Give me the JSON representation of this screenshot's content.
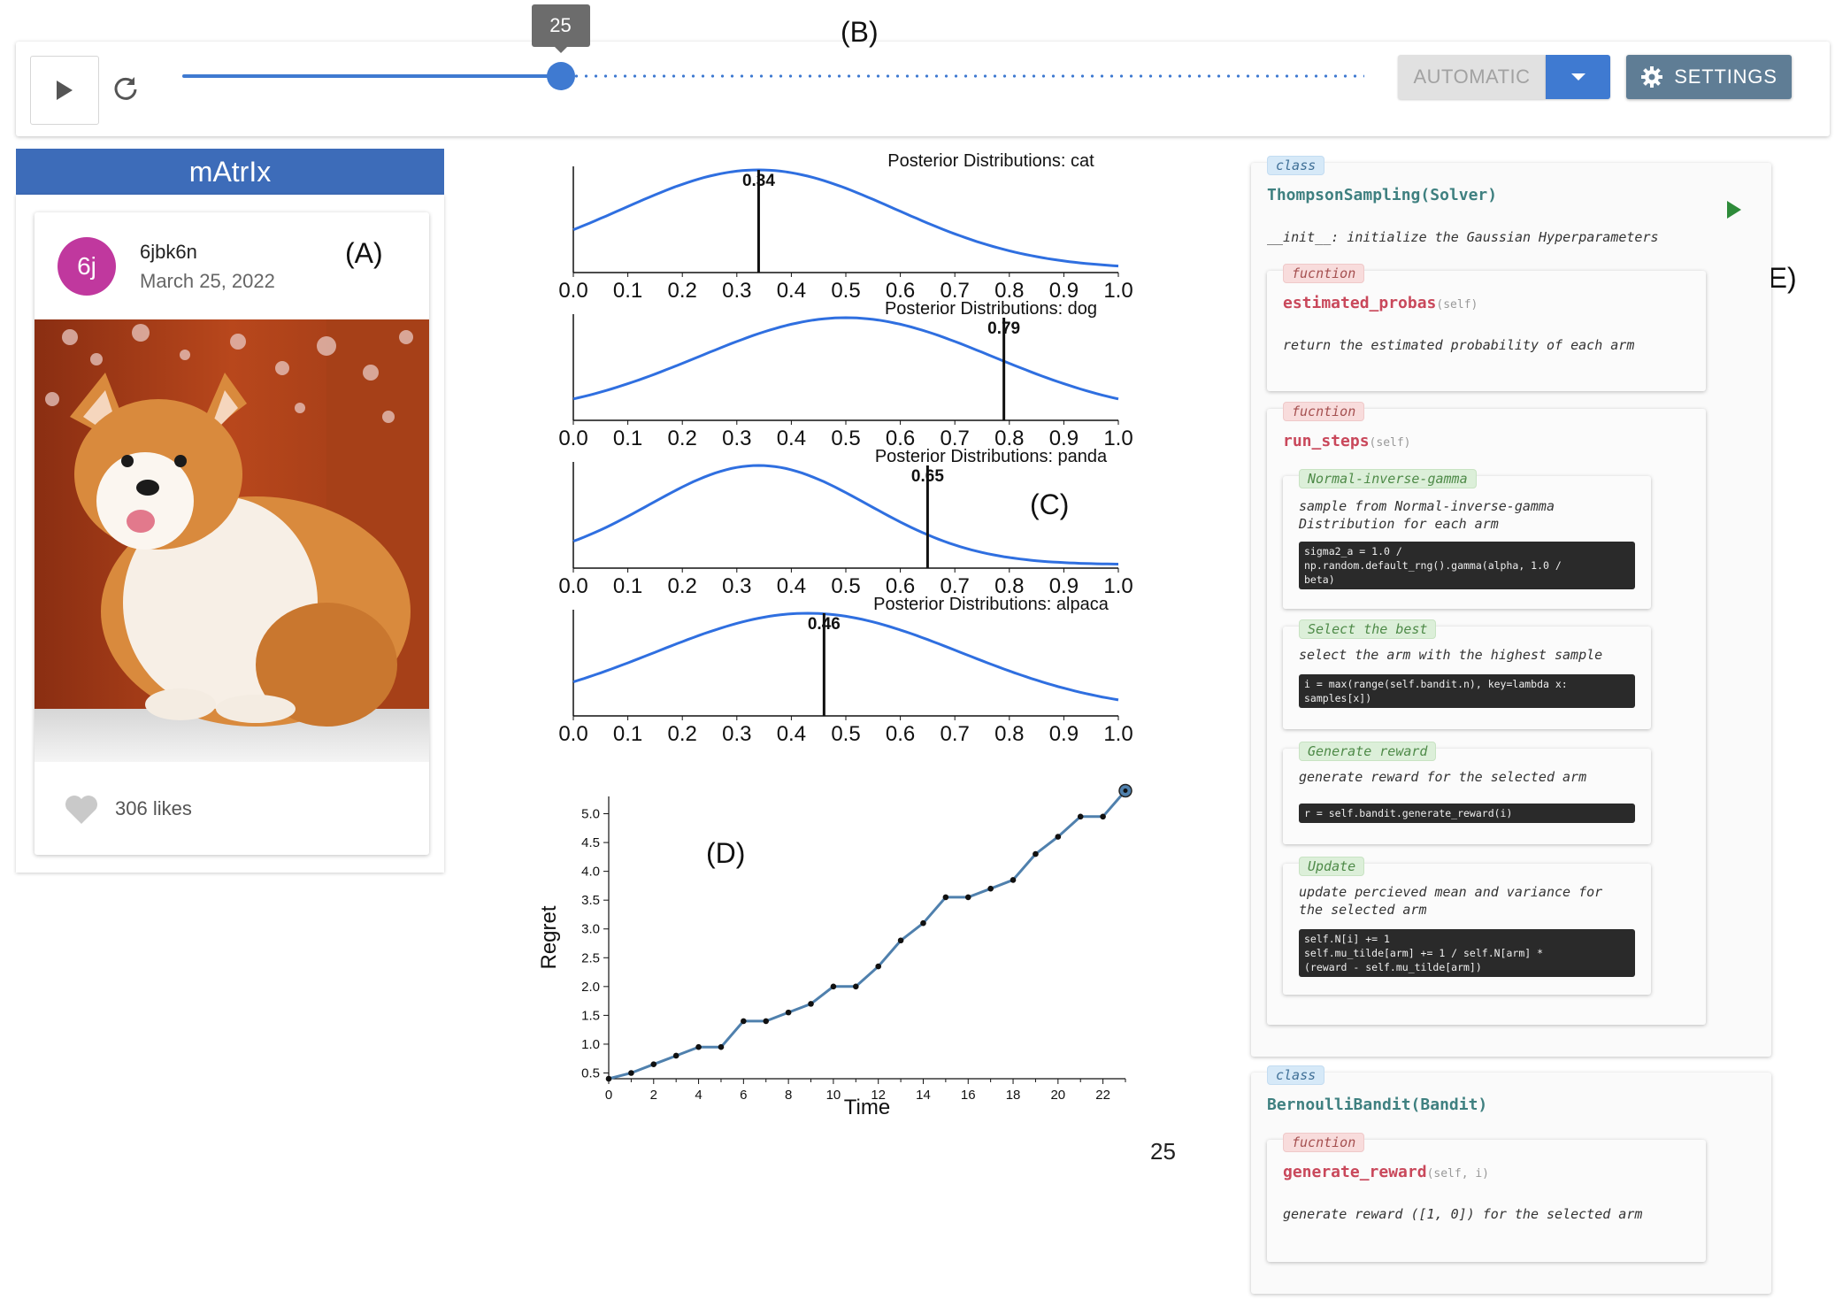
{
  "toolbar": {
    "slider_value": "25",
    "slider_fraction": 0.32,
    "mode_label": "AUTOMATIC",
    "settings_label": "SETTINGS"
  },
  "annotations": {
    "a": "(A)",
    "b": "(B)",
    "c": "(C)",
    "d": "(D)",
    "e": "(E)"
  },
  "panel": {
    "title": "mAtrIx",
    "post": {
      "avatar_initials": "6j",
      "username": "6jbk6n",
      "date": "March 25, 2022",
      "likes": "306 likes",
      "image": "corgi-photo"
    }
  },
  "posteriors": [
    {
      "title": "Posterior Distributions: cat",
      "mean": 0.34,
      "label": "0.34",
      "mu": 0.34,
      "sigma": 0.25
    },
    {
      "title": "Posterior Distributions: dog",
      "mean": 0.79,
      "label": "0.79",
      "mu": 0.5,
      "sigma": 0.27
    },
    {
      "title": "Posterior Distributions: panda",
      "mean": 0.65,
      "label": "0.65",
      "mu": 0.34,
      "sigma": 0.2
    },
    {
      "title": "Posterior Distributions: alpaca",
      "mean": 0.46,
      "label": "0.46",
      "mu": 0.43,
      "sigma": 0.28
    }
  ],
  "posterior_ticks": [
    "0.0",
    "0.1",
    "0.2",
    "0.3",
    "0.4",
    "0.5",
    "0.6",
    "0.7",
    "0.8",
    "0.9",
    "1.0"
  ],
  "chart_data": {
    "type": "line",
    "xlabel": "Time",
    "ylabel": "Regret",
    "xlim": [
      0,
      23
    ],
    "ylim": [
      0.4,
      5.3
    ],
    "xticks": [
      0,
      2,
      4,
      6,
      8,
      10,
      12,
      14,
      16,
      18,
      20,
      22
    ],
    "yticks": [
      0.5,
      1.0,
      1.5,
      2.0,
      2.5,
      3.0,
      3.5,
      4.0,
      4.5,
      5.0
    ],
    "x": [
      0,
      1,
      2,
      3,
      4,
      5,
      6,
      7,
      8,
      9,
      10,
      11,
      12,
      13,
      14,
      15,
      16,
      17,
      18,
      19,
      20,
      21,
      22,
      23
    ],
    "y": [
      0.4,
      0.5,
      0.65,
      0.8,
      0.95,
      0.95,
      1.4,
      1.4,
      1.55,
      1.7,
      2.0,
      2.0,
      2.35,
      2.8,
      3.1,
      3.55,
      3.55,
      3.7,
      3.85,
      4.3,
      4.6,
      4.95,
      4.95,
      5.4
    ]
  },
  "step_label": "25",
  "code": {
    "class1": {
      "chip": "class",
      "name": "ThompsonSampling(Solver)",
      "init": "__init__: initialize the Gaussian Hyperparameters",
      "fn1": {
        "chip": "fucntion",
        "name": "estimated_probas",
        "args": "(self)",
        "desc": "return the estimated probability of each arm"
      },
      "fn2": {
        "chip": "fucntion",
        "name": "run_steps",
        "args": "(self)",
        "steps": [
          {
            "chip": "Normal-inverse-gamma",
            "desc": "sample from Normal-inverse-gamma\nDistribution for each arm",
            "code": "sigma2_a = 1.0 /\nnp.random.default_rng().gamma(alpha, 1.0 /\nbeta)"
          },
          {
            "chip": "Select the best",
            "desc": "select the arm with the highest sample",
            "code": "i = max(range(self.bandit.n), key=lambda x:\nsamples[x])"
          },
          {
            "chip": "Generate reward",
            "desc": "generate reward for the selected arm",
            "code": "r = self.bandit.generate_reward(i)"
          },
          {
            "chip": "Update",
            "desc": "update percieved mean and variance for\nthe selected arm",
            "code": "self.N[i] += 1\nself.mu_tilde[arm] += 1 / self.N[arm] *\n(reward - self.mu_tilde[arm])"
          }
        ]
      }
    },
    "class2": {
      "chip": "class",
      "name": "BernoulliBandit(Bandit)",
      "fn1": {
        "chip": "fucntion",
        "name": "generate_reward",
        "args": "(self, i)",
        "desc": "generate reward ([1, 0]) for the selected arm"
      }
    }
  },
  "colors": {
    "accent": "#3f7ad1",
    "header": "#3d6cb9",
    "curve": "#2f6fe0",
    "regret_line": "#4f80ad"
  }
}
